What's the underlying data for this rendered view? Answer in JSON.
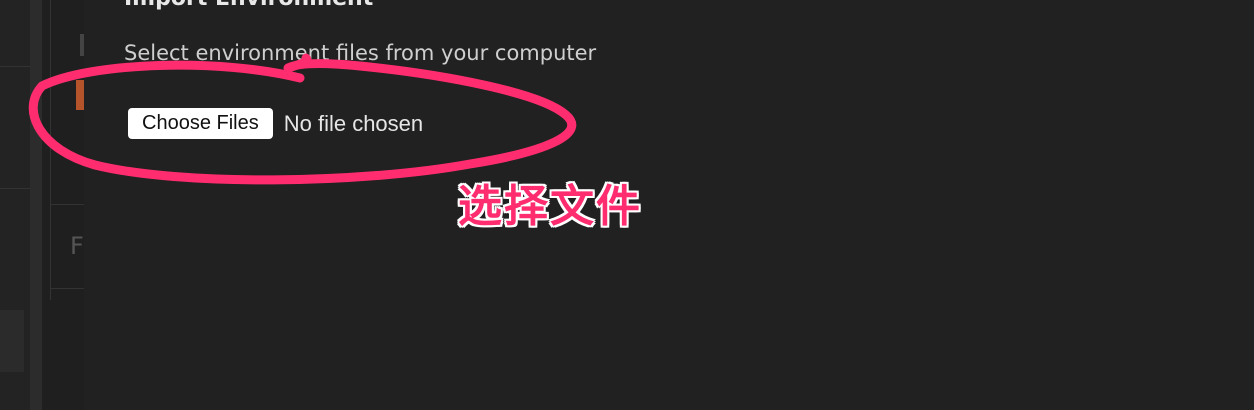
{
  "modal": {
    "title": "Import Environment",
    "subtitle": "Select environment files from your computer",
    "choose_files_label": "Choose Files",
    "file_status": "No file chosen"
  },
  "background": {
    "partial_letter": "F"
  },
  "annotation": {
    "text": "选择文件",
    "color": "#ff2d6f"
  }
}
